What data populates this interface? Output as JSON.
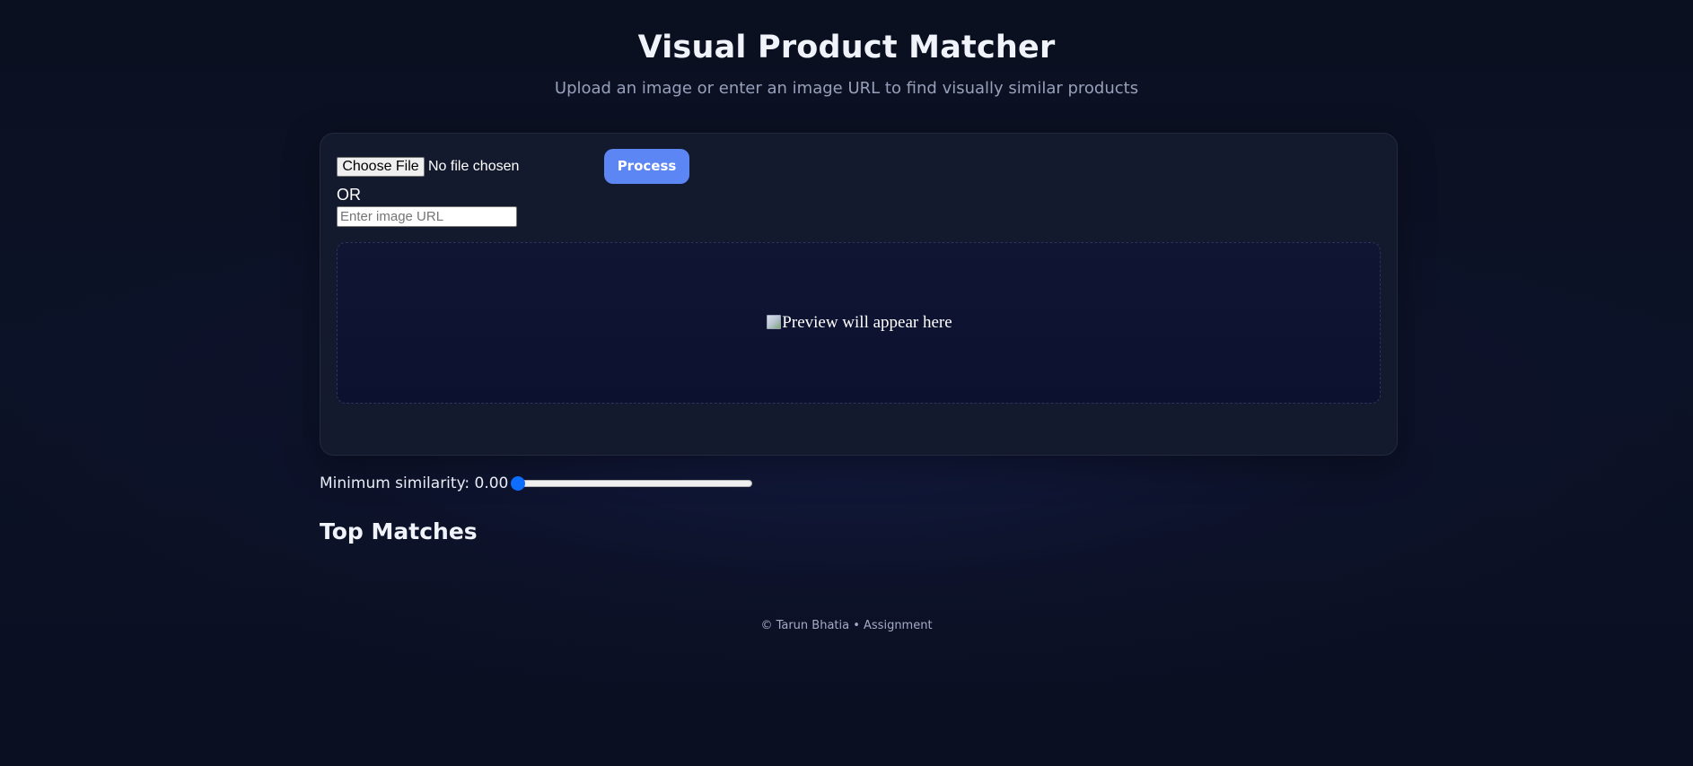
{
  "header": {
    "title": "Visual Product Matcher",
    "subtitle": "Upload an image or enter an image URL to find visually similar products"
  },
  "upload": {
    "file_button_label": "Choose File",
    "file_status": "No file chosen",
    "process_label": "Process",
    "or_label": "OR",
    "url_placeholder": "Enter image URL",
    "url_value": ""
  },
  "preview": {
    "alt_text": "Preview will appear here",
    "icon": "broken-image-icon"
  },
  "filters": {
    "similarity_label": "Minimum similarity: 0.00",
    "similarity_value": 0.0
  },
  "results": {
    "heading": "Top Matches"
  },
  "footer": {
    "text": "© Tarun Bhatia • Assignment"
  },
  "colors": {
    "accent": "#5b86f3",
    "slider": "#0d6efd",
    "background": "#0b1020",
    "card": "#141a2e"
  }
}
